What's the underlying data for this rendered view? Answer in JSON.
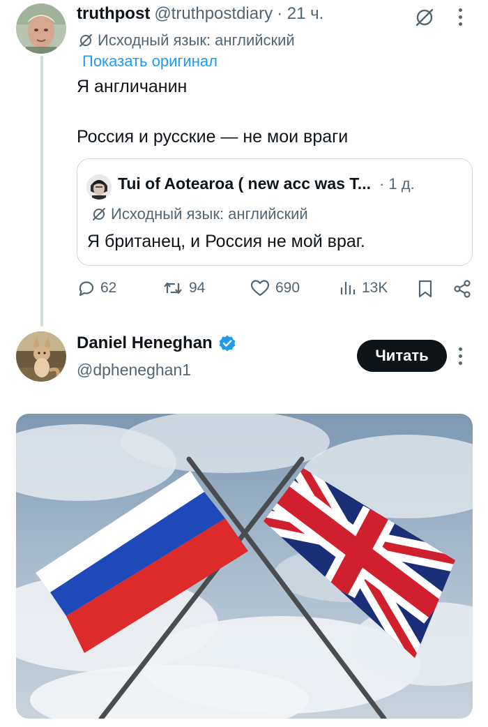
{
  "tweet1": {
    "display_name": "truthpost",
    "handle": "@truthpostdiary",
    "time": "· 21 ч.",
    "lang_note": "Исходный язык: английский",
    "show_original": "Показать оригинал",
    "line1": "Я англичанин",
    "line2": "Россия и русские — не мои враги",
    "quote": {
      "display_name": "Tui of Aotearoa ( new acc was T...",
      "time": "· 1 д.",
      "lang_note": "Исходный язык: английский",
      "text": "Я британец, и Россия не мой враг."
    },
    "stats": {
      "replies": "62",
      "reposts": "94",
      "likes": "690",
      "views": "13K"
    }
  },
  "tweet2": {
    "display_name": "Daniel Heneghan",
    "handle": "@dpheneghan1",
    "follow_label": "Читать"
  },
  "colors": {
    "accent": "#1d9bf0",
    "muted": "#536471",
    "text": "#0f1419",
    "border": "#cfd9de"
  },
  "icons": [
    "translate-icon",
    "more-icon",
    "reply-icon",
    "repost-icon",
    "like-icon",
    "views-icon",
    "bookmark-icon",
    "share-icon",
    "verified-badge-icon"
  ]
}
